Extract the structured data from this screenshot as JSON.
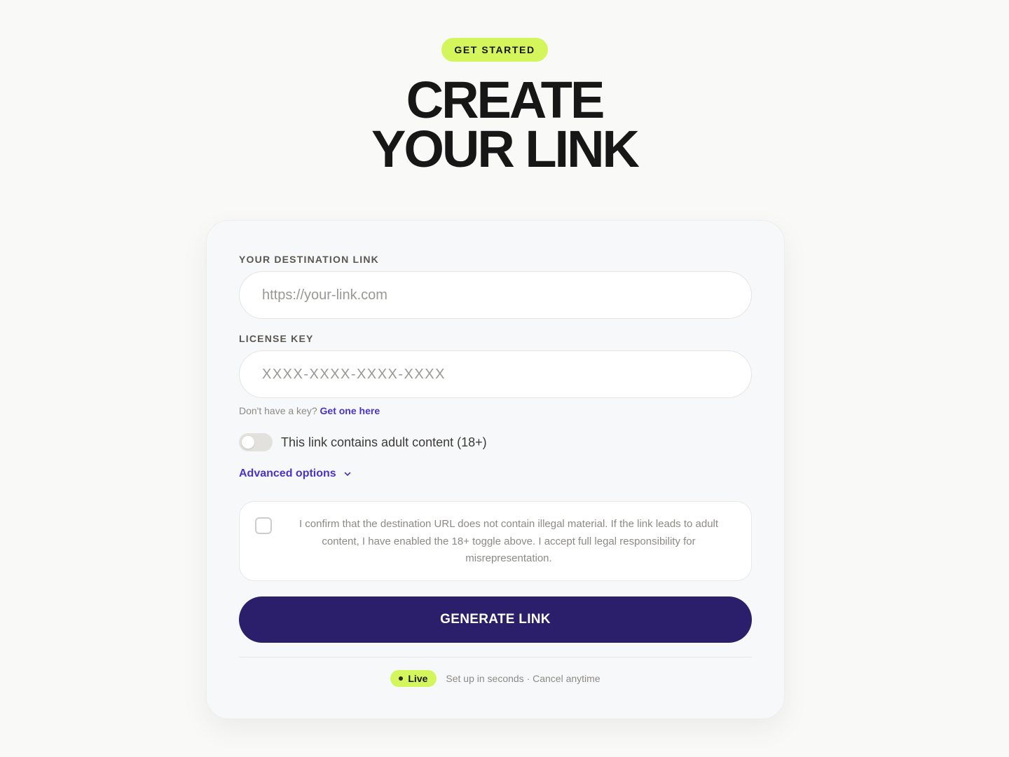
{
  "header": {
    "badge": "GET STARTED",
    "title_line1": "CREATE",
    "title_line2": "YOUR LINK"
  },
  "form": {
    "destination": {
      "label": "YOUR DESTINATION LINK",
      "placeholder": "https://your-link.com",
      "value": ""
    },
    "license": {
      "label": "LICENSE KEY",
      "placeholder": "XXXX-XXXX-XXXX-XXXX",
      "value": ""
    },
    "helper": {
      "text": "Don't have a key?",
      "link": "Get one here"
    },
    "adult_toggle": {
      "label": "This link contains adult content (18+)",
      "checked": false
    },
    "advanced": {
      "label": "Advanced options"
    },
    "confirm": {
      "text": "I confirm that the destination URL does not contain illegal material. If the link leads to adult content, I have enabled the 18+ toggle above. I accept full legal responsibility for misrepresentation.",
      "checked": false
    },
    "submit_label": "GENERATE LINK"
  },
  "footer": {
    "status": "Live",
    "text": "Set up in seconds · Cancel anytime"
  },
  "colors": {
    "accent_lime": "#d4f55c",
    "primary_button": "#2b1f6b",
    "link_purple": "#4b33c9",
    "background": "#f9f9f8"
  },
  "icons": {
    "advanced_chevron": "chevron-down-icon",
    "live_indicator": "status-dot-icon"
  }
}
